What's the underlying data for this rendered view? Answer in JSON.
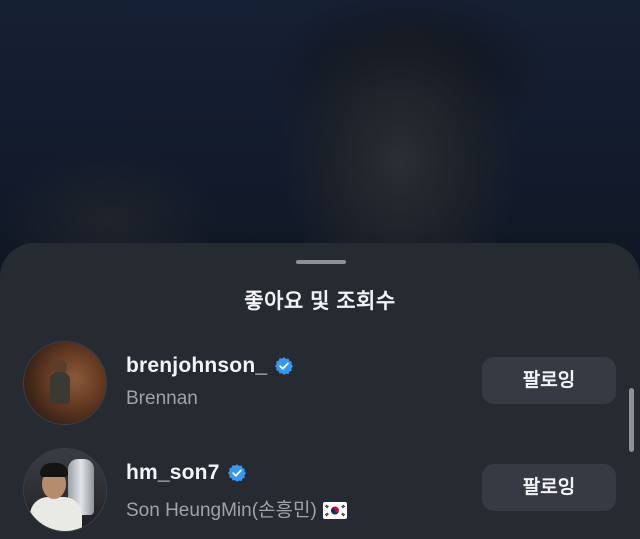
{
  "sheet": {
    "title": "좋아요 및 조회수"
  },
  "users": [
    {
      "username": "brenjohnson_",
      "full_name": "Brennan",
      "verified": true,
      "follow_label": "팔로잉"
    },
    {
      "username": "hm_son7",
      "full_name": "Son HeungMin(손흥민)",
      "verified": true,
      "follow_label": "팔로잉"
    }
  ],
  "colors": {
    "sheet_bg": "#262a31",
    "button_bg": "#363a42",
    "verified_blue": "#3897f0",
    "secondary_text": "#9ea3ab"
  },
  "icons": {
    "verified": "verified-badge-icon",
    "flag": "south-korea-flag-icon"
  }
}
